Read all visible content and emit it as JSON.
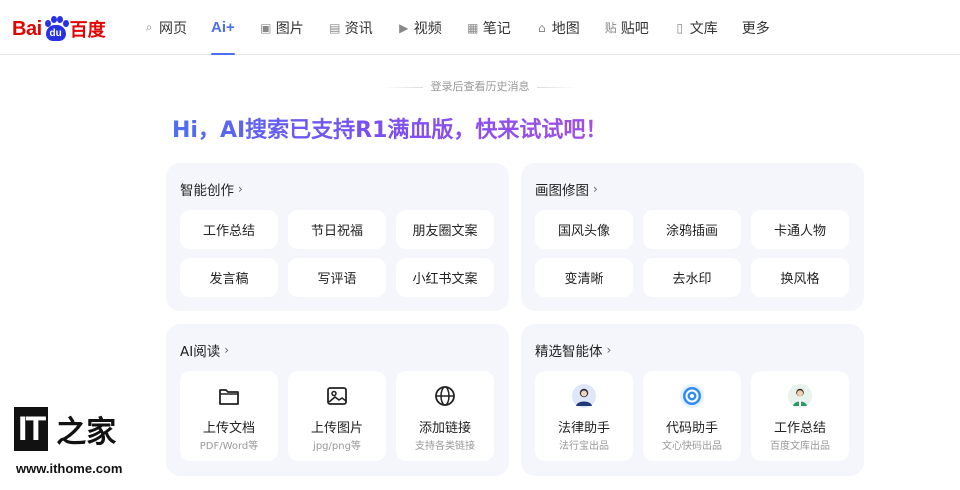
{
  "logo": {
    "text_latin": "Bai",
    "paw_text": "du",
    "text_cn": "百度"
  },
  "nav": [
    {
      "label": "网页",
      "icon": "search-icon",
      "glyph": "⌕"
    },
    {
      "label": "Ai+",
      "icon": "",
      "glyph": "",
      "active": true
    },
    {
      "label": "图片",
      "icon": "image-icon",
      "glyph": "▣"
    },
    {
      "label": "资讯",
      "icon": "news-icon",
      "glyph": "▤"
    },
    {
      "label": "视频",
      "icon": "video-icon",
      "glyph": "▶"
    },
    {
      "label": "笔记",
      "icon": "note-icon",
      "glyph": "▦"
    },
    {
      "label": "地图",
      "icon": "map-pin-icon",
      "glyph": "⌂"
    },
    {
      "label": "贴吧",
      "icon": "tieba-icon",
      "glyph": "贴"
    },
    {
      "label": "文库",
      "icon": "doc-icon",
      "glyph": "▯"
    },
    {
      "label": "更多",
      "icon": "",
      "glyph": ""
    }
  ],
  "login_hint": "登录后查看历史消息",
  "headline": "Hi，AI搜索已支持R1满血版，快来试试吧！",
  "cards": {
    "create": {
      "title": "智能创作",
      "chips": [
        "工作总结",
        "节日祝福",
        "朋友圈文案",
        "发言稿",
        "写评语",
        "小红书文案"
      ]
    },
    "draw": {
      "title": "画图修图",
      "chips": [
        "国风头像",
        "涂鸦插画",
        "卡通人物",
        "变清晰",
        "去水印",
        "换风格"
      ]
    },
    "read": {
      "title": "AI阅读",
      "tiles": [
        {
          "name": "上传文档",
          "sub": "PDF/Word等",
          "icon": "folder-icon"
        },
        {
          "name": "上传图片",
          "sub": "jpg/png等",
          "icon": "image-upload-icon"
        },
        {
          "name": "添加链接",
          "sub": "支持各类链接",
          "icon": "globe-icon"
        }
      ]
    },
    "agents": {
      "title": "精选智能体",
      "tiles": [
        {
          "name": "法律助手",
          "sub": "法行宝出品",
          "icon": "lawyer-avatar-icon"
        },
        {
          "name": "代码助手",
          "sub": "文心快码出品",
          "icon": "code-assistant-icon"
        },
        {
          "name": "工作总结",
          "sub": "百度文库出品",
          "icon": "worker-avatar-icon"
        }
      ]
    }
  },
  "watermark": {
    "big": "IT",
    "cn": "之家",
    "url": "www.ithome.com"
  },
  "colors": {
    "brand_red": "#e10602",
    "brand_blue": "#2932e1",
    "accent": "#4e6ef2",
    "card_bg": "#f5f6fc"
  }
}
